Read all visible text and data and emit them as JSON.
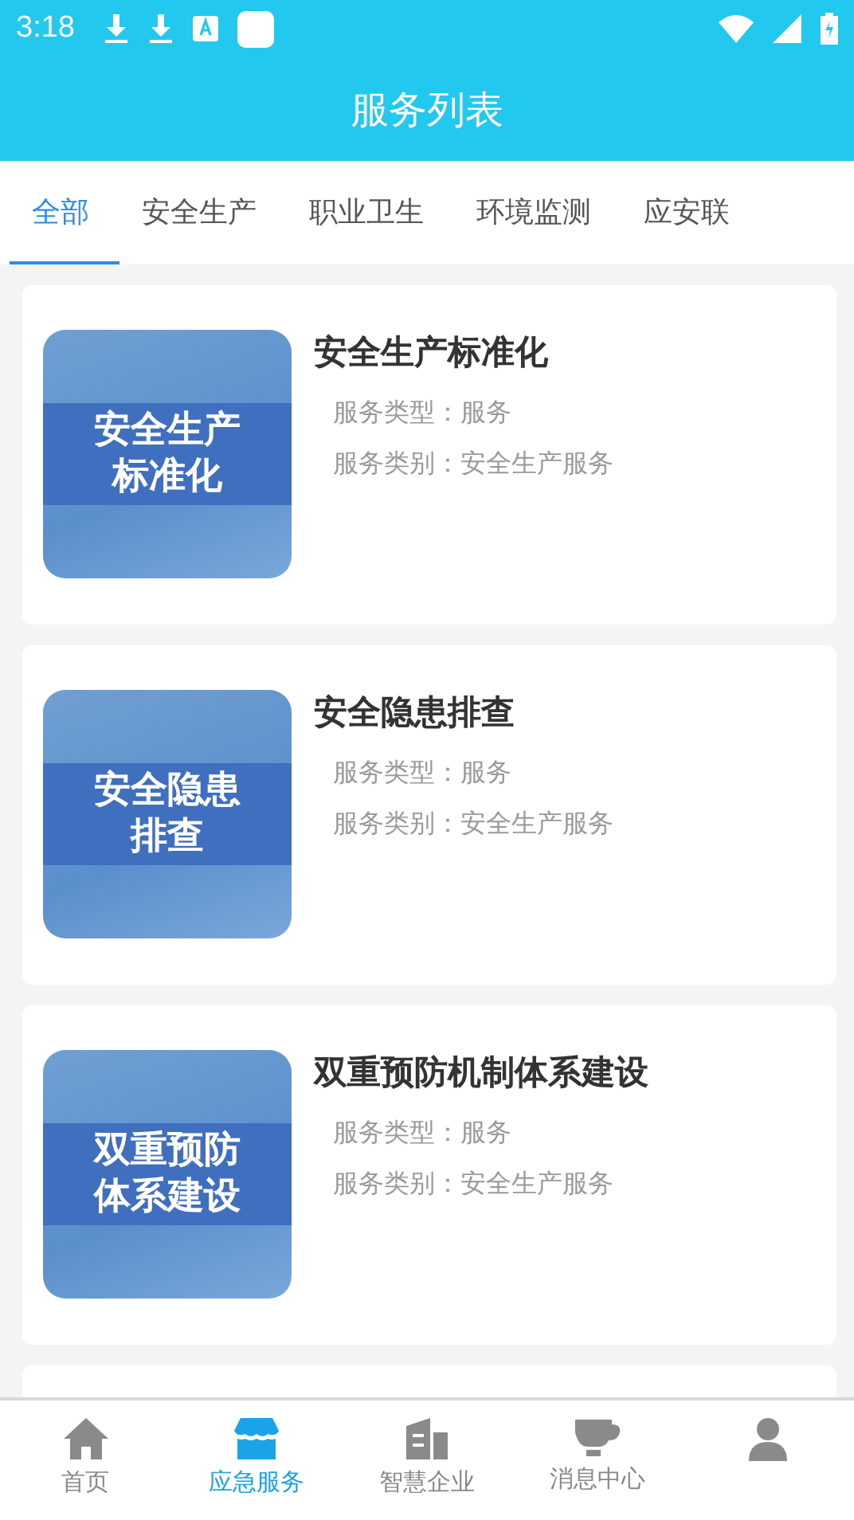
{
  "status_bar": {
    "time": "3:18"
  },
  "header": {
    "title": "服务列表"
  },
  "tabs": [
    {
      "label": "全部",
      "selected": true
    },
    {
      "label": "安全生产",
      "selected": false
    },
    {
      "label": "职业卫生",
      "selected": false
    },
    {
      "label": "环境监测",
      "selected": false
    },
    {
      "label": "应安联",
      "selected": false
    }
  ],
  "services": [
    {
      "thumb_lines": [
        "安全生产",
        "标准化"
      ],
      "title": "安全生产标准化",
      "type_label": "服务类型：",
      "type_value": "服务",
      "category_label": "服务类别：",
      "category_value": "安全生产服务"
    },
    {
      "thumb_lines": [
        "安全隐患",
        "排查"
      ],
      "title": "安全隐患排查",
      "type_label": "服务类型：",
      "type_value": "服务",
      "category_label": "服务类别：",
      "category_value": "安全生产服务"
    },
    {
      "thumb_lines": [
        "双重预防",
        "体系建设"
      ],
      "title": "双重预防机制体系建设",
      "type_label": "服务类型：",
      "type_value": "服务",
      "category_label": "服务类别：",
      "category_value": "安全生产服务"
    }
  ],
  "bottom_nav": [
    {
      "kind": "home",
      "label": "首页",
      "selected": false
    },
    {
      "kind": "store",
      "label": "应急服务",
      "selected": true
    },
    {
      "kind": "building",
      "label": "智慧企业",
      "selected": false
    },
    {
      "kind": "cup",
      "label": "消息中心",
      "selected": false
    },
    {
      "kind": "person",
      "selected": false
    }
  ]
}
